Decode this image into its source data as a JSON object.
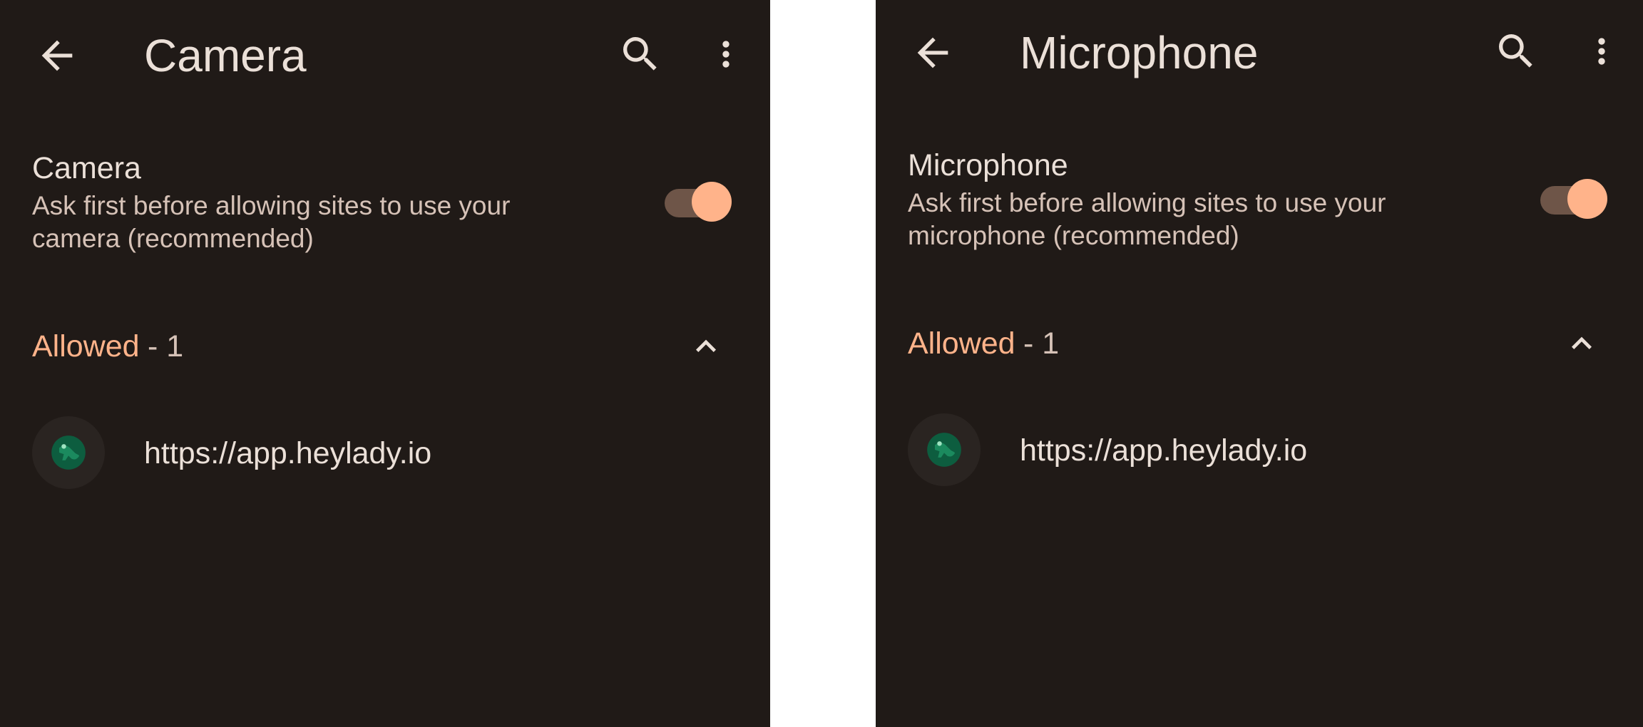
{
  "panels": [
    {
      "title": "Camera",
      "setting": {
        "title": "Camera",
        "description": "Ask first before allowing sites to use your camera (recommended)",
        "enabled": true
      },
      "section": {
        "label": "Allowed",
        "count": "- 1",
        "expanded": true
      },
      "sites": [
        {
          "url": "https://app.heylady.io"
        }
      ]
    },
    {
      "title": "Microphone",
      "setting": {
        "title": "Microphone",
        "description": "Ask first before allowing sites to use your microphone (recommended)",
        "enabled": true
      },
      "section": {
        "label": "Allowed",
        "count": "- 1",
        "expanded": true
      },
      "sites": [
        {
          "url": "https://app.heylady.io"
        }
      ]
    }
  ],
  "icons": {
    "back": "arrow-back-icon",
    "search": "search-icon",
    "more": "more-vert-icon",
    "collapse": "chevron-up-icon",
    "favicon": "site-favicon-icon"
  },
  "colors": {
    "background": "#201a17",
    "accent": "#ffb38a",
    "toggle_track": "#6e5548",
    "text_primary": "#ebe0d8",
    "text_secondary": "#d6c2b7",
    "favicon": "#0d5d3f"
  }
}
